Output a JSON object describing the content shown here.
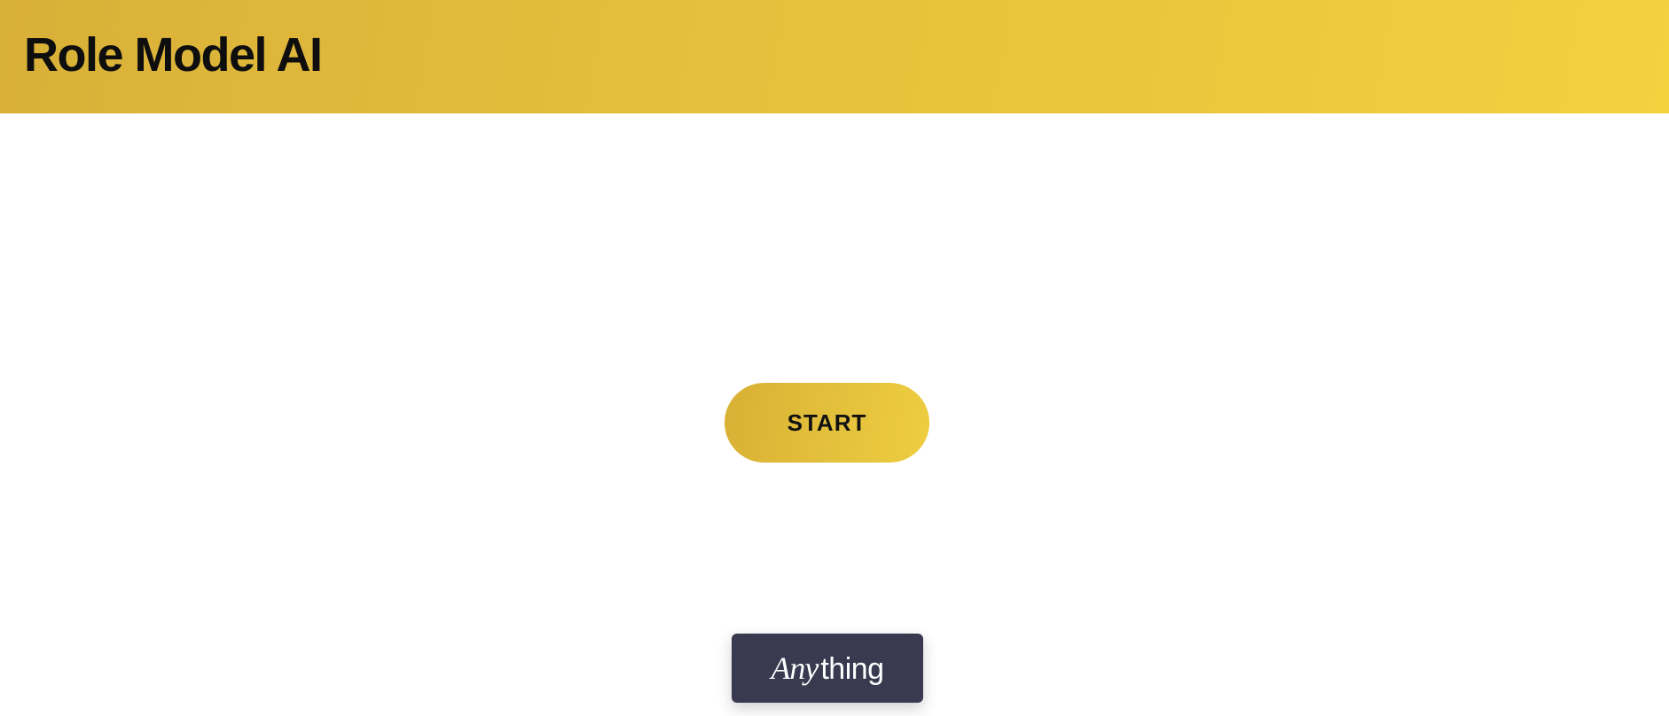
{
  "header": {
    "title": "Role Model AI"
  },
  "main": {
    "start_label": "START"
  },
  "badge": {
    "italic_part": "Any",
    "plain_part": "thing"
  },
  "colors": {
    "header_gradient_start": "#d9b038",
    "header_gradient_end": "#f3d13f",
    "button_gradient_start": "#d8b034",
    "button_gradient_end": "#efcd40",
    "badge_background": "#393a50",
    "title_text": "#0e0e0e",
    "page_background": "#ffffff"
  }
}
